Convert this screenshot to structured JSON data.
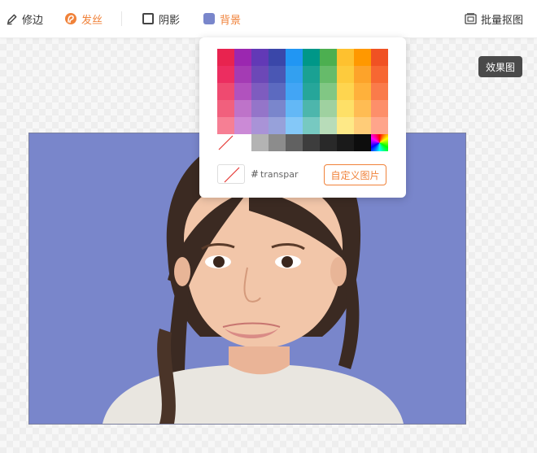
{
  "toolbar": {
    "edge": {
      "label": "修边",
      "icon": "pen-icon"
    },
    "hair": {
      "label": "发丝",
      "icon": "hair-icon"
    },
    "shadow": {
      "label": "阴影",
      "icon": "square-outline-icon"
    },
    "background": {
      "label": "背景",
      "icon": "color-swatch-icon",
      "swatch_color": "#7986cb"
    },
    "batch": {
      "label": "批量抠图",
      "icon": "batch-image-icon"
    }
  },
  "tooltip": {
    "label": "效果图"
  },
  "color_picker": {
    "palette_rows": [
      [
        "#e8234f",
        "#9b27b0",
        "#6239b6",
        "#3a47a9",
        "#2196f3",
        "#009788",
        "#4caf50",
        "#fec12f",
        "#ff9800",
        "#f05223"
      ],
      [
        "#ec2d60",
        "#a43bb4",
        "#6c48b7",
        "#4a57b4",
        "#33a0f0",
        "#1aa193",
        "#66bb6a",
        "#fdcb3d",
        "#fda32a",
        "#f76732"
      ],
      [
        "#ef4a70",
        "#b152be",
        "#7e5cbf",
        "#5c6ac0",
        "#42a5f5",
        "#26a69a",
        "#81c784",
        "#fed54f",
        "#ffb13b",
        "#fa7b4a"
      ],
      [
        "#f1607d",
        "#be73c9",
        "#9475c9",
        "#7a86cc",
        "#63b8f6",
        "#4db6ac",
        "#9fd1a0",
        "#fee067",
        "#ffbc53",
        "#fd8f6a"
      ],
      [
        "#f67f94",
        "#cb8ad6",
        "#a993d7",
        "#97a1da",
        "#84c8f8",
        "#77c9c1",
        "#b8dcb9",
        "#fee987",
        "#ffcc78",
        "#ffa58b"
      ],
      [
        "none",
        "#ffffff",
        "#b3b3b3",
        "#8c8c8c",
        "#616161",
        "#3d3d3d",
        "#292929",
        "#1a1a1a",
        "#0d0d0d",
        "spectrum"
      ]
    ],
    "hex_prefix": "#",
    "hex_value": "transparent",
    "custom_image_label": "自定义图片"
  },
  "canvas": {
    "background_color": "#7986cb"
  }
}
